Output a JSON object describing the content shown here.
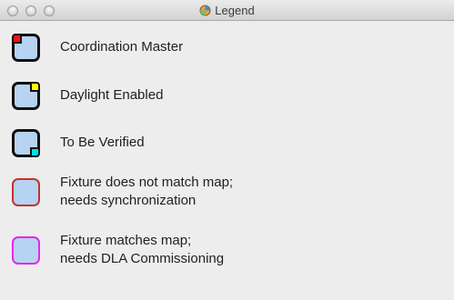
{
  "window": {
    "title": "Legend"
  },
  "legend": {
    "items": [
      {
        "label": "Coordination Master"
      },
      {
        "label": "Daylight Enabled"
      },
      {
        "label": "To Be Verified"
      },
      {
        "label_line1": "Fixture does not match map;",
        "label_line2": "needs synchronization"
      },
      {
        "label_line1": "Fixture matches map;",
        "label_line2": "needs DLA Commissioning"
      }
    ]
  },
  "colors": {
    "swatch_fill": "#b7d3f2",
    "coordination_master_marker": "#ff1010",
    "daylight_enabled_marker": "#ffff00",
    "to_be_verified_marker": "#00e0e0",
    "mismatch_border": "#c4322c",
    "dla_commissioning_border": "#ea25e6"
  }
}
